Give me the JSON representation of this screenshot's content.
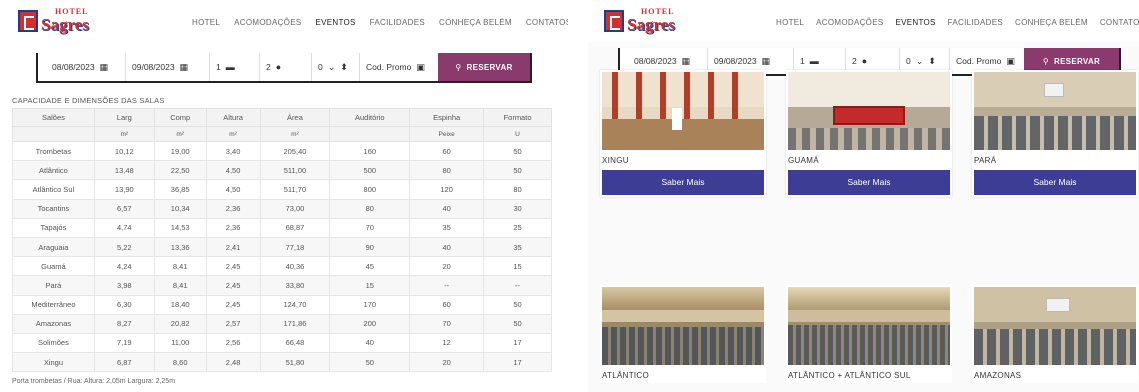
{
  "brand": {
    "top": "HOTEL",
    "name": "Sagres"
  },
  "nav": [
    "HOTEL",
    "ACOMODAÇÕES",
    "EVENTOS",
    "FACILIDADES",
    "CONHEÇA BELÉM",
    "CONTATOS"
  ],
  "booking": {
    "checkin": "08/08/2023",
    "checkout": "09/08/2023",
    "rooms": "1",
    "adults": "2",
    "children": "0",
    "promo_placeholder": "Cod. Promo",
    "reserve_label": "RESERVAR"
  },
  "table": {
    "caption": "CAPACIDADE E DIMENSÕES DAS SALAS",
    "headers": [
      "Salões",
      "Larg",
      "Comp",
      "Altura",
      "Área",
      "Auditório",
      "Espinha",
      "Formato"
    ],
    "subheaders": [
      "",
      "m²",
      "m²",
      "m²",
      "m²",
      "",
      "Peixe",
      "U"
    ],
    "rows": [
      [
        "Trombetas",
        "10,12",
        "19,00",
        "3,40",
        "205,40",
        "160",
        "60",
        "50"
      ],
      [
        "Atlântico",
        "13,48",
        "22,50",
        "4,50",
        "511,00",
        "500",
        "80",
        "50"
      ],
      [
        "Atlântico Sul",
        "13,90",
        "36,85",
        "4,50",
        "511,70",
        "800",
        "120",
        "80"
      ],
      [
        "Tocantins",
        "6,57",
        "10,34",
        "2,36",
        "73,00",
        "80",
        "40",
        "30"
      ],
      [
        "Tapajós",
        "4,74",
        "14,53",
        "2,36",
        "68,87",
        "70",
        "35",
        "25"
      ],
      [
        "Araguaia",
        "5,22",
        "13,36",
        "2,41",
        "77,18",
        "90",
        "40",
        "35"
      ],
      [
        "Guamá",
        "4,24",
        "8,41",
        "2,45",
        "40,36",
        "45",
        "20",
        "15"
      ],
      [
        "Pará",
        "3,98",
        "8,41",
        "2,45",
        "33,80",
        "15",
        "--",
        "--"
      ],
      [
        "Mediterrâneo",
        "6,30",
        "18,40",
        "2,45",
        "124,70",
        "170",
        "60",
        "50"
      ],
      [
        "Amazonas",
        "8,27",
        "20,82",
        "2,57",
        "171,86",
        "200",
        "70",
        "50"
      ],
      [
        "Solimões",
        "7,19",
        "11,00",
        "2,56",
        "66,48",
        "40",
        "12",
        "17"
      ],
      [
        "Xingu",
        "6,87",
        "8,60",
        "2,48",
        "51,80",
        "50",
        "20",
        "17"
      ]
    ],
    "footnote": "Porta trombetas / Rua: Altura: 2,05m Largura: 2,25m"
  },
  "rooms": [
    {
      "name": "XINGU",
      "button": "Saber Mais",
      "photo": "room-orange-curtains"
    },
    {
      "name": "GUAMÁ",
      "button": "Saber Mais",
      "photo": "room-red-u-table"
    },
    {
      "name": "PARÁ",
      "button": "Saber Mais",
      "photo": "room-chairs-screen"
    },
    {
      "name": "ATLÂNTICO",
      "button": "",
      "photo": "hall-auditorium"
    },
    {
      "name": "ATLÂNTICO + ATLÂNTICO SUL",
      "button": "",
      "photo": "hall-large"
    },
    {
      "name": "AMAZONAS",
      "button": "",
      "photo": "room-auditorium-screen"
    }
  ],
  "colors": {
    "brand_red": "#d32f2f",
    "brand_blue": "#1b3f8f",
    "reserve": "#8b3a6e",
    "saber": "#3d3d95"
  },
  "icons": [
    "calendar-icon",
    "bed-icon",
    "user-icon",
    "child-icon",
    "gift-icon",
    "search-icon",
    "chevron-down-icon"
  ]
}
